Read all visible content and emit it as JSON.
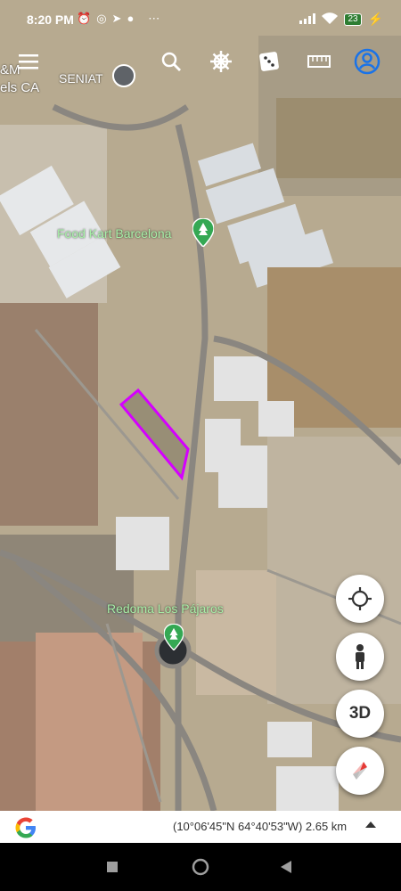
{
  "status_bar": {
    "time": "8:20 PM",
    "battery": "23"
  },
  "toolbar": {
    "icons": [
      "menu-icon",
      "search-icon",
      "voyager-wheel-icon",
      "dice-icon",
      "ruler-icon",
      "account-icon"
    ]
  },
  "map": {
    "labels": {
      "top_left_line1": "&M",
      "top_left_line2": "els CA",
      "seniat": "SENIAT",
      "food_kart": "Food Kart Barcelona",
      "redoma": "Redoma Los Pájaros"
    },
    "polygon_color": "#d400ff"
  },
  "controls": {
    "three_d_label": "3D"
  },
  "bottom_bar": {
    "coordinates": "(10°06'45\"N 64°40'53\"W) 2.65 km"
  },
  "colors": {
    "accent": "#1a73e8",
    "polygon": "#d400ff"
  }
}
